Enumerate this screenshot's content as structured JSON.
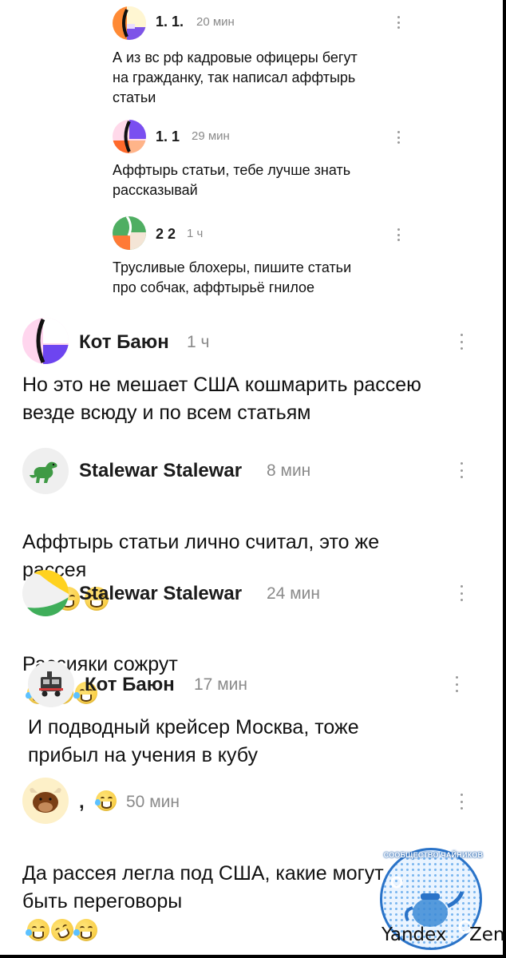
{
  "comments": [
    {
      "name": "1. 1.",
      "time": "20 мин",
      "text": "А из вс рф кадровые офицеры бегут\nна гражданку, так написал аффтырь\nстатьи",
      "avatar": "abstract-orange-purple"
    },
    {
      "name": "1. 1",
      "time": "29 мин",
      "text": "Аффтырь статьи, тебе лучше знать\nрассказывай",
      "avatar": "abstract-pink-violet"
    },
    {
      "name": "2 2",
      "time": "1 ч",
      "text": "Трусливые блохеры, пишите статьи\nпро собчак, аффтырьё гнилое",
      "avatar": "abstract-green-orange"
    },
    {
      "name": "Кот Баюн",
      "time": "1 ч",
      "text": "Но это не мешает США кошмарить рассею\nвезде всюду и по всем статьям",
      "avatar": "abstract-pink-violet-white"
    },
    {
      "name": "Stalewar Stalewar",
      "time": "8 мин",
      "text": "Аффтырь статьи лично считал, это же\nрассея",
      "avatar": "dinosaur"
    },
    {
      "name": "Stalewar Stalewar",
      "time": "24 мин",
      "text": "Рассияки сожрут",
      "avatar": "abstract-yellow-green"
    },
    {
      "name": "Кот Баюн",
      "time": "17 мин",
      "text": "И подводный крейсер Москва, тоже\nприбыл на учения в кубу",
      "avatar": "train"
    },
    {
      "name": ",",
      "time": "50 мин",
      "text": "Да рассея легла под США, какие могут\nбыть переговоры",
      "avatar": "bull"
    }
  ],
  "watermark": {
    "title": "СООБЩЕСТВО ЧАЙНИКОВ",
    "left": "Yandex",
    "right": "Zen"
  },
  "colors": {
    "background": "#ffffff",
    "frame": "#000000",
    "time": "#8a8a8a",
    "watermark_blue": "#2a73c8"
  }
}
